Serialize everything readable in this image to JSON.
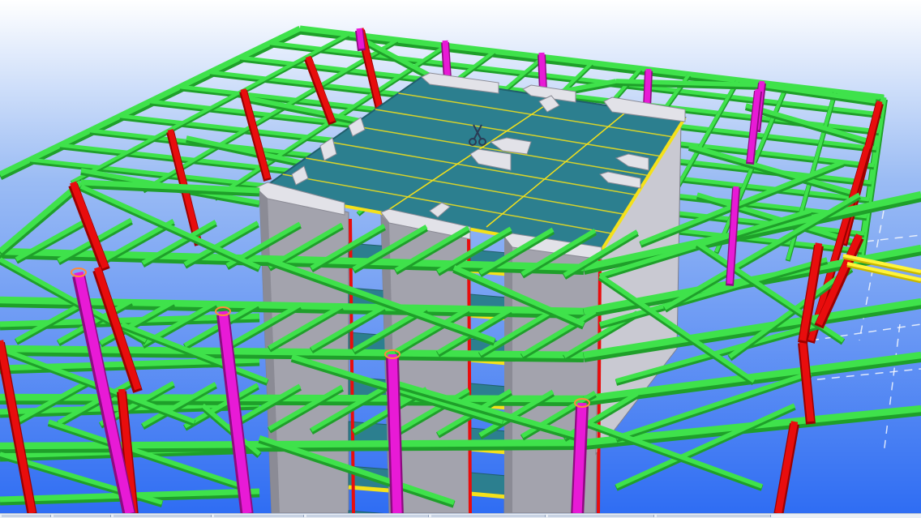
{
  "scene": {
    "description_free": true,
    "background": {
      "top": "#ffffff",
      "bottom": "#2f6df3"
    },
    "colors": {
      "beam": "#3fe24b",
      "beam_dark": "#1f9f2a",
      "brace": "#e80d0d",
      "brace_dark": "#9b0000",
      "column": "#e81ad6",
      "column_dark": "#8d0b80",
      "core_wall": "#a3a3ad",
      "core_wall_light": "#c9c9d2",
      "slab": "#2c7f8f",
      "slab_dark": "#215f6c",
      "joist": "#f4e11a"
    },
    "icons": {
      "cursor": "scissors-icon"
    }
  },
  "statusbar": {
    "segments": 8
  }
}
